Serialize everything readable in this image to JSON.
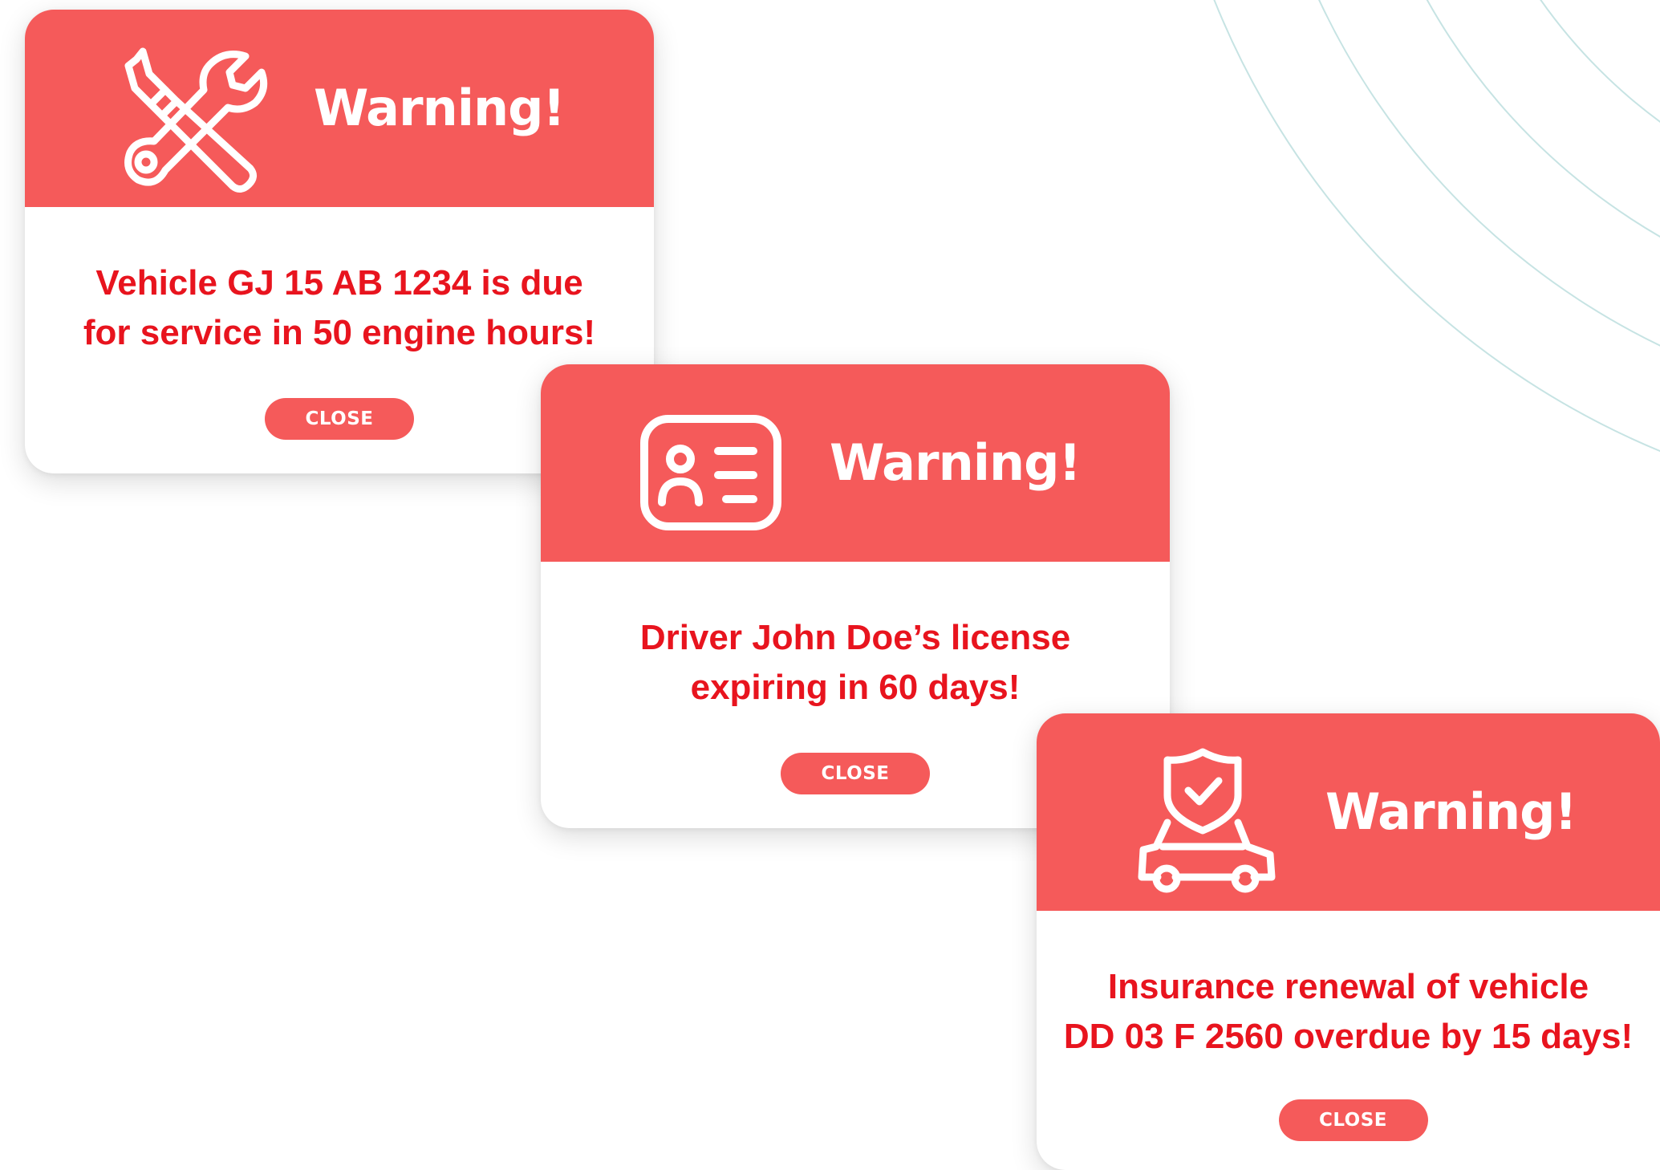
{
  "colors": {
    "header_background": "#f55a5a",
    "message_text": "#e8141e",
    "button_background": "#f55a5a",
    "button_text": "#ffffff",
    "decorative_arcs": "#b9dddd"
  },
  "notifications": [
    {
      "icon": "wrench-screwdriver-icon",
      "title": "Warning!",
      "message_lines": [
        "Vehicle GJ 15 AB 1234 is due",
        "for service in 50 engine hours!"
      ],
      "close_label": "CLOSE"
    },
    {
      "icon": "id-card-icon",
      "title": "Warning!",
      "message_lines": [
        "Driver John Doe’s license",
        "expiring in 60 days!"
      ],
      "close_label": "CLOSE"
    },
    {
      "icon": "car-insurance-shield-icon",
      "title": "Warning!",
      "message_lines": [
        "Insurance renewal of vehicle",
        "DD 03 F 2560 overdue by 15 days!"
      ],
      "close_label": "CLOSE"
    }
  ]
}
